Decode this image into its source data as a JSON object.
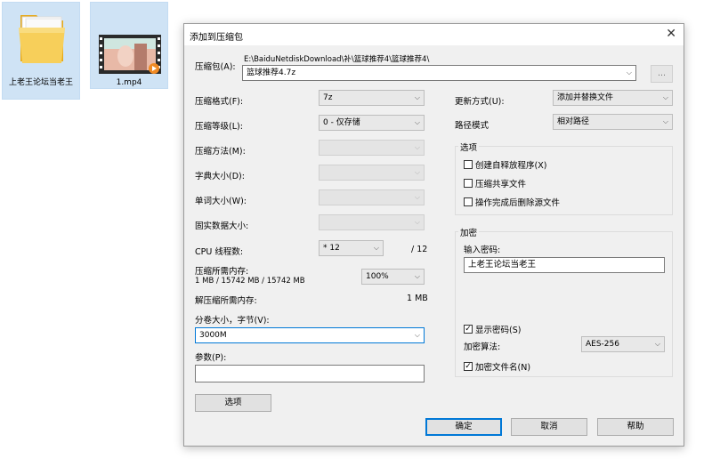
{
  "desktop": {
    "folder_label": "上老王论坛当老王",
    "video_label": "1.mp4"
  },
  "dialog": {
    "title": "添加到压缩包",
    "close_glyph": "✕",
    "archive": {
      "label": "压缩包(A):",
      "path": "E:\\BaiduNetdiskDownload\\补\\篮球推荐4\\篮球推荐4\\",
      "filename": "篮球推荐4.7z",
      "browse_label": "..."
    },
    "left": {
      "format": {
        "label": "压缩格式(F):",
        "value": "7z"
      },
      "level": {
        "label": "压缩等级(L):",
        "value": "0 - 仅存储"
      },
      "method": {
        "label": "压缩方法(M):",
        "value": ""
      },
      "dict": {
        "label": "字典大小(D):",
        "value": ""
      },
      "word": {
        "label": "单词大小(W):",
        "value": ""
      },
      "solid": {
        "label": "固实数据大小:",
        "value": ""
      },
      "cpu": {
        "label": "CPU 线程数:",
        "value": "* 12",
        "max": "/ 12"
      },
      "mem": {
        "label": "压缩所需内存:",
        "detail": "1 MB / 15742 MB / 15742 MB",
        "percent": "100%"
      },
      "decomp": {
        "label": "解压缩所需内存:",
        "value": "1 MB"
      },
      "split": {
        "label": "分卷大小，字节(V):",
        "value": "3000M"
      },
      "params": {
        "label": "参数(P):",
        "value": ""
      },
      "options_button": "选项"
    },
    "right": {
      "update": {
        "label": "更新方式(U):",
        "value": "添加并替换文件"
      },
      "path_mode": {
        "label": "路径模式",
        "value": "相对路径"
      },
      "options_group": {
        "title": "选项",
        "sfx": "创建自释放程序(X)",
        "shared": "压缩共享文件",
        "delete": "操作完成后删除源文件"
      },
      "encryption": {
        "title": "加密",
        "password_label": "输入密码:",
        "password_value": "上老王论坛当老王",
        "show_password": "显示密码(S)",
        "method_label": "加密算法:",
        "method_value": "AES-256",
        "encrypt_names": "加密文件名(N)"
      }
    },
    "buttons": {
      "ok": "确定",
      "cancel": "取消",
      "help": "帮助"
    }
  },
  "glyphs": {
    "arrow": "⌵",
    "check": "✓"
  },
  "colors": {
    "accent": "#0078d7",
    "folder": "#f4c542",
    "selection": "#cfe3f5"
  }
}
